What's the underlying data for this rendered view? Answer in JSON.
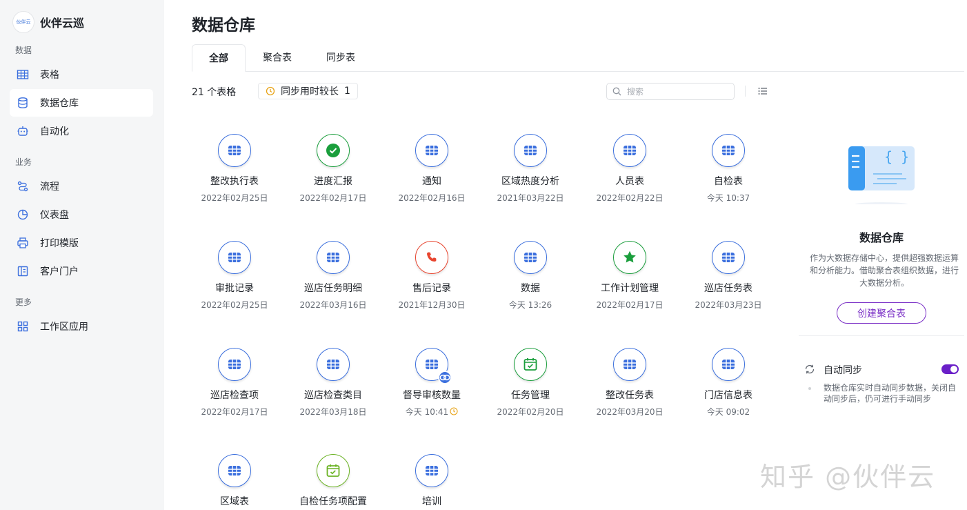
{
  "app": {
    "name": "伙伴云巡",
    "logo_text": "伙伴云"
  },
  "sidebar": {
    "sections": [
      {
        "label": "数据"
      },
      {
        "label": "业务"
      },
      {
        "label": "更多"
      }
    ],
    "items": [
      {
        "label": "表格",
        "icon": "table-icon"
      },
      {
        "label": "数据仓库",
        "icon": "database-icon",
        "active": true
      },
      {
        "label": "自动化",
        "icon": "robot-icon"
      },
      {
        "label": "流程",
        "icon": "workflow-icon"
      },
      {
        "label": "仪表盘",
        "icon": "dashboard-icon"
      },
      {
        "label": "打印模版",
        "icon": "printer-icon"
      },
      {
        "label": "客户门户",
        "icon": "portal-icon"
      },
      {
        "label": "工作区应用",
        "icon": "apps-icon"
      }
    ]
  },
  "main": {
    "title": "数据仓库",
    "tabs": [
      {
        "label": "全部"
      },
      {
        "label": "聚合表"
      },
      {
        "label": "同步表"
      }
    ],
    "count_text": "21 个表格",
    "sync_chip": {
      "label": "同步用时较长",
      "count": "1"
    },
    "search": {
      "placeholder": "搜索"
    },
    "cards": [
      {
        "name": "整改执行表",
        "date": "2022年02月25日",
        "icon": "grid-icon"
      },
      {
        "name": "进度汇报",
        "date": "2022年02月17日",
        "icon": "check-circle-icon"
      },
      {
        "name": "通知",
        "date": "2022年02月16日",
        "icon": "grid-icon"
      },
      {
        "name": "区域热度分析",
        "date": "2021年03月22日",
        "icon": "grid-icon"
      },
      {
        "name": "人员表",
        "date": "2022年02月22日",
        "icon": "grid-icon"
      },
      {
        "name": "自检表",
        "date": "今天 10:37",
        "icon": "grid-icon"
      },
      {
        "name": "审批记录",
        "date": "2022年02月25日",
        "icon": "grid-icon"
      },
      {
        "name": "巡店任务明细",
        "date": "2022年03月16日",
        "icon": "grid-icon"
      },
      {
        "name": "售后记录",
        "date": "2021年12月30日",
        "icon": "phone-icon"
      },
      {
        "name": "数据",
        "date": "今天 13:26",
        "icon": "grid-icon"
      },
      {
        "name": "工作计划管理",
        "date": "2022年02月17日",
        "icon": "star-icon"
      },
      {
        "name": "巡店任务表",
        "date": "2022年03月23日",
        "icon": "grid-icon"
      },
      {
        "name": "巡店检查项",
        "date": "2022年02月17日",
        "icon": "grid-icon"
      },
      {
        "name": "巡店检查类目",
        "date": "2022年03月18日",
        "icon": "grid-icon"
      },
      {
        "name": "督导审核数量",
        "date": "今天 10:41",
        "icon": "grid-icon"
      },
      {
        "name": "任务管理",
        "date": "2022年02月20日",
        "icon": "calendar-check-icon"
      },
      {
        "name": "整改任务表",
        "date": "2022年03月20日",
        "icon": "grid-icon"
      },
      {
        "name": "门店信息表",
        "date": "今天 09:02",
        "icon": "grid-icon"
      },
      {
        "name": "区域表",
        "date": "",
        "icon": "grid-icon"
      },
      {
        "name": "自检任务项配置",
        "date": "",
        "icon": "calendar-check-icon"
      },
      {
        "name": "培训",
        "date": "",
        "icon": "grid-icon"
      }
    ]
  },
  "panel": {
    "title": "数据仓库",
    "description": "作为大数据存储中心，提供超强数据运算和分析能力。借助聚合表组织数据，进行大数据分析。",
    "create_button": "创建聚合表",
    "auto_sync": {
      "label": "自动同步",
      "enabled": true,
      "description": "数据仓库实时自动同步数据，关闭自动同步后，仍可进行手动同步"
    }
  },
  "watermark": "知乎 @伙伴云",
  "colors": {
    "accent": "#3b6fde",
    "purple": "#7a2fc6",
    "green": "#1a9e3c",
    "red": "#e8452f",
    "orange": "#e8a317",
    "lime": "#6bb324"
  }
}
